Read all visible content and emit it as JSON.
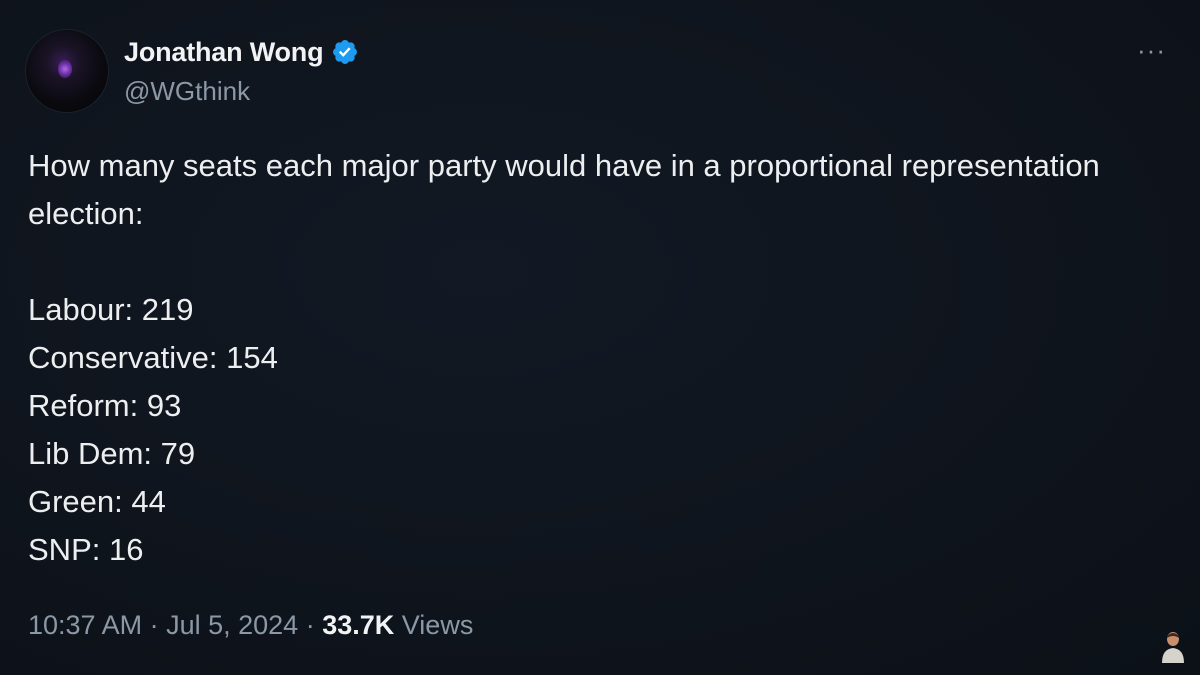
{
  "author": {
    "name": "Jonathan Wong",
    "handle": "@WGthink",
    "verified": true,
    "verified_color": "#1d9bf0",
    "avatar_accent": "#9b59d0"
  },
  "more_menu": {
    "icon": "ellipsis-icon",
    "glyph": "···"
  },
  "tweet": {
    "intro": "How many seats each major party would have in a proportional representation election:",
    "lines": [
      "Labour: 219",
      "Conservative: 154",
      "Reform: 93",
      "Lib Dem: 79",
      "Green: 44",
      "SNP: 16"
    ]
  },
  "meta": {
    "time": "10:37 AM",
    "separator": "·",
    "date": "Jul 5, 2024",
    "views_count": "33.7K",
    "views_label": "Views"
  },
  "colors": {
    "background": "#0f141c",
    "text": "#e7e9ea",
    "muted": "#8b98a5"
  }
}
